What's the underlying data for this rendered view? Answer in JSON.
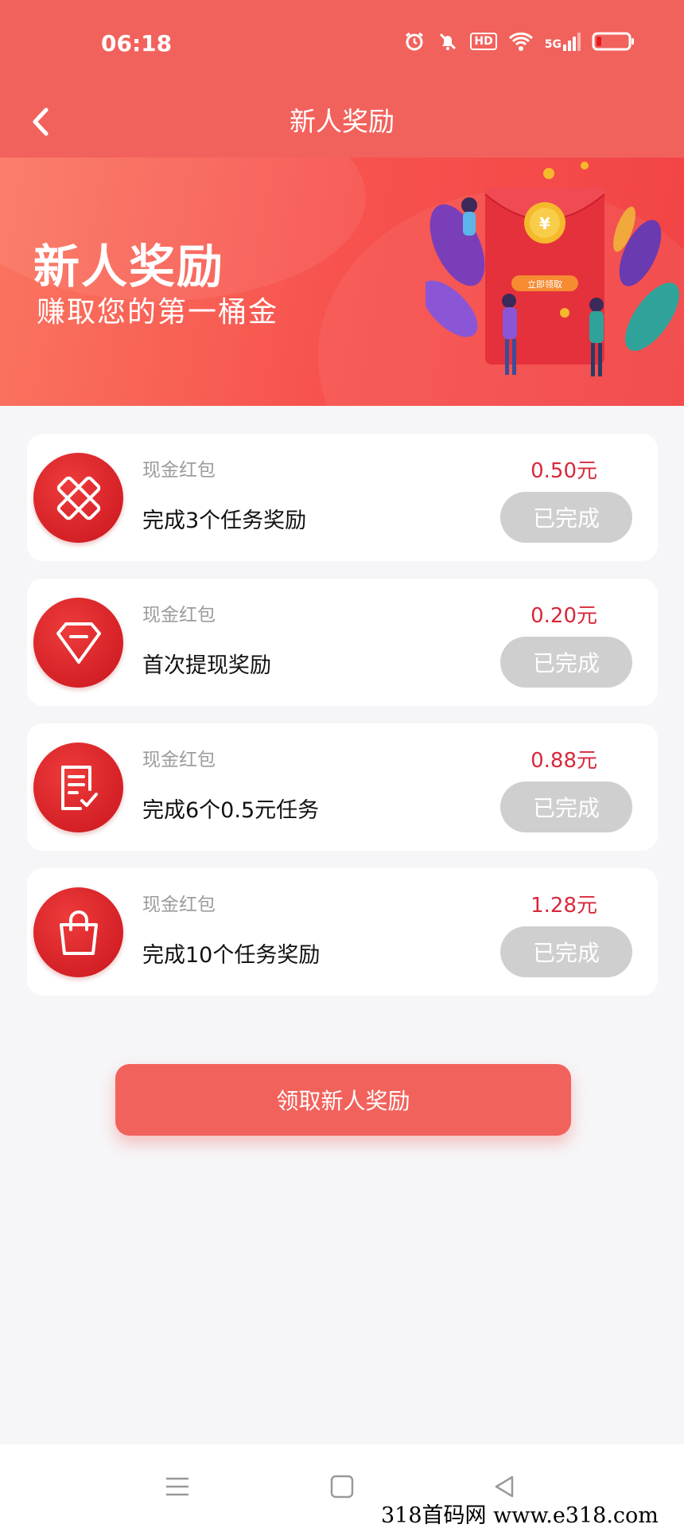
{
  "status_bar": {
    "time": "06:18",
    "hd_label": "HD",
    "network_label": "5G"
  },
  "nav": {
    "title": "新人奖励"
  },
  "banner": {
    "title": "新人奖励",
    "subtitle": "赚取您的第一桶金",
    "illustration_button": "立即领取"
  },
  "rewards": [
    {
      "category": "现金红包",
      "title": "完成3个任务奖励",
      "amount": "0.50元",
      "status": "已完成",
      "icon": "tools-icon"
    },
    {
      "category": "现金红包",
      "title": "首次提现奖励",
      "amount": "0.20元",
      "status": "已完成",
      "icon": "diamond-icon"
    },
    {
      "category": "现金红包",
      "title": "完成6个0.5元任务",
      "amount": "0.88元",
      "status": "已完成",
      "icon": "document-check-icon"
    },
    {
      "category": "现金红包",
      "title": "完成10个任务奖励",
      "amount": "1.28元",
      "status": "已完成",
      "icon": "shopping-bag-icon"
    }
  ],
  "claim_button": {
    "label": "领取新人奖励"
  },
  "watermark": {
    "text": "318首码网 www.e318.com"
  },
  "colors": {
    "primary": "#f2625c",
    "amount": "#d8293b",
    "done_button": "#cfcfcf"
  }
}
